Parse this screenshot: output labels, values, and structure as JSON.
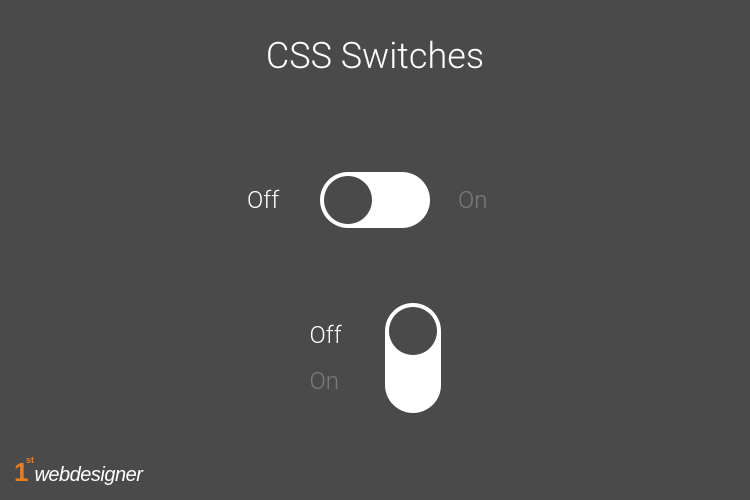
{
  "title": "CSS Switches",
  "switch1": {
    "offLabel": "Off",
    "onLabel": "On",
    "state": "off"
  },
  "switch2": {
    "offLabel": "Off",
    "onLabel": "On",
    "state": "off"
  },
  "logo": {
    "prefix": "1",
    "suffix": "st",
    "text": "webdesigner"
  }
}
